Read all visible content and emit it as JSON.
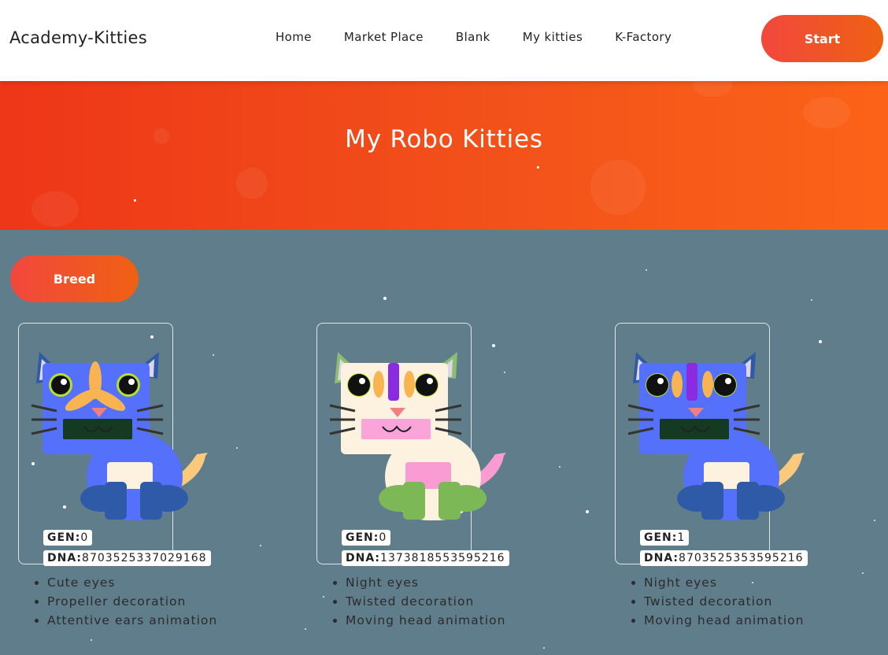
{
  "nav": {
    "brand": "Academy-Kitties",
    "links": [
      "Home",
      "Market Place",
      "Blank",
      "My kitties",
      "K-Factory"
    ],
    "start_label": "Start"
  },
  "hero": {
    "title": "My Robo Kitties"
  },
  "actions": {
    "breed_label": "Breed"
  },
  "kitties": [
    {
      "gen_label": "GEN:",
      "gen": "0",
      "dna_label": "DNA:",
      "dna": "8703525337029168",
      "attributes": [
        "Cute eyes",
        "Propeller decoration",
        "Attentive ears animation"
      ],
      "colors": {
        "body": "#5570fa",
        "face": "#5570fa",
        "ear_outer": "#2f5aa8",
        "ear_inner": "#ddd6e8",
        "paws": "#2f5aa8",
        "belly": "#fdf2df",
        "tail": "#fbc97c",
        "mouth_box": "#143a22",
        "decoration": "#f9b452",
        "eye_ring": "#b7e02e"
      }
    },
    {
      "gen_label": "GEN:",
      "gen": "0",
      "dna_label": "DNA:",
      "dna": "1373818553595216",
      "attributes": [
        "Night eyes",
        "Twisted decoration",
        "Moving head animation"
      ],
      "colors": {
        "body": "#fdf2df",
        "face": "#fdf2df",
        "ear_outer": "#8dbd6f",
        "ear_inner": "#dcd6e6",
        "paws": "#7cb956",
        "belly": "#fb9bd3",
        "tail": "#fb9bd3",
        "mouth_box": "#fba4da",
        "decoration": "#f9b452",
        "decoration_mid": "#8a2be2",
        "eye_ring": "#b7e02e"
      }
    },
    {
      "gen_label": "GEN:",
      "gen": "1",
      "dna_label": "DNA:",
      "dna": "8703525353595216",
      "attributes": [
        "Night eyes",
        "Twisted decoration",
        "Moving head animation"
      ],
      "colors": {
        "body": "#5570fa",
        "face": "#5570fa",
        "ear_outer": "#2f5aa8",
        "ear_inner": "#ddd6e8",
        "paws": "#2f5aa8",
        "belly": "#fdf2df",
        "tail": "#fbc97c",
        "mouth_box": "#143a22",
        "decoration": "#f9b452",
        "decoration_mid": "#8a2be2",
        "eye_ring": "#b7e02e"
      }
    }
  ]
}
